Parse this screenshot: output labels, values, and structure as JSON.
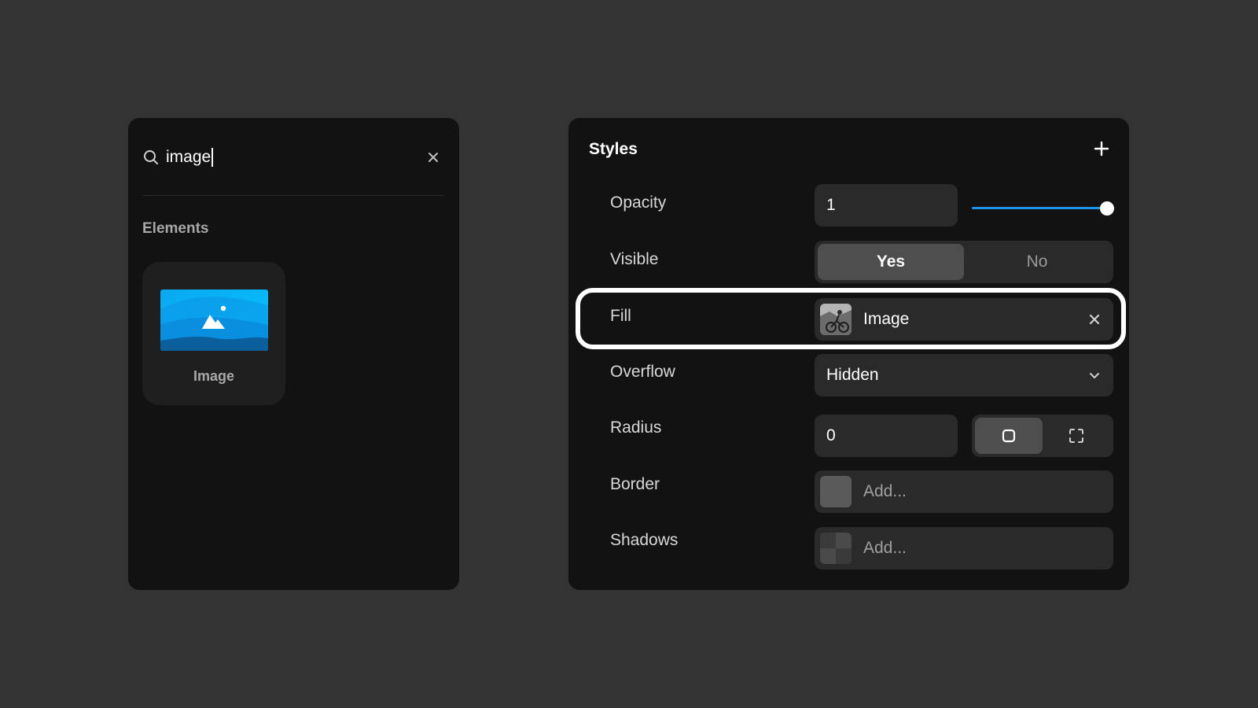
{
  "search": {
    "value": "image",
    "clear_icon": "close-icon"
  },
  "elements_section": {
    "title": "Elements",
    "items": [
      {
        "label": "Image",
        "icon": "image-placeholder-icon"
      }
    ]
  },
  "styles": {
    "title": "Styles",
    "add_icon": "plus-icon",
    "rows": {
      "opacity": {
        "label": "Opacity",
        "value": "1",
        "slider_value": 1.0,
        "slider_color": "#1d94e8"
      },
      "visible": {
        "label": "Visible",
        "options": [
          "Yes",
          "No"
        ],
        "selected": "Yes"
      },
      "fill": {
        "label": "Fill",
        "value": "Image",
        "clear_icon": "close-icon",
        "highlighted": true
      },
      "overflow": {
        "label": "Overflow",
        "value": "Hidden",
        "icon": "chevron-down-icon"
      },
      "radius": {
        "label": "Radius",
        "value": "0",
        "modes": [
          "uniform-corners-icon",
          "individual-corners-icon"
        ],
        "selected_mode": "uniform-corners-icon"
      },
      "border": {
        "label": "Border",
        "placeholder": "Add..."
      },
      "shadows": {
        "label": "Shadows",
        "placeholder": "Add..."
      }
    }
  },
  "colors": {
    "background": "#333333",
    "panel": "#121212",
    "field": "#2a2a2a",
    "accent": "#1d94e8",
    "highlight": "#ffffff"
  }
}
